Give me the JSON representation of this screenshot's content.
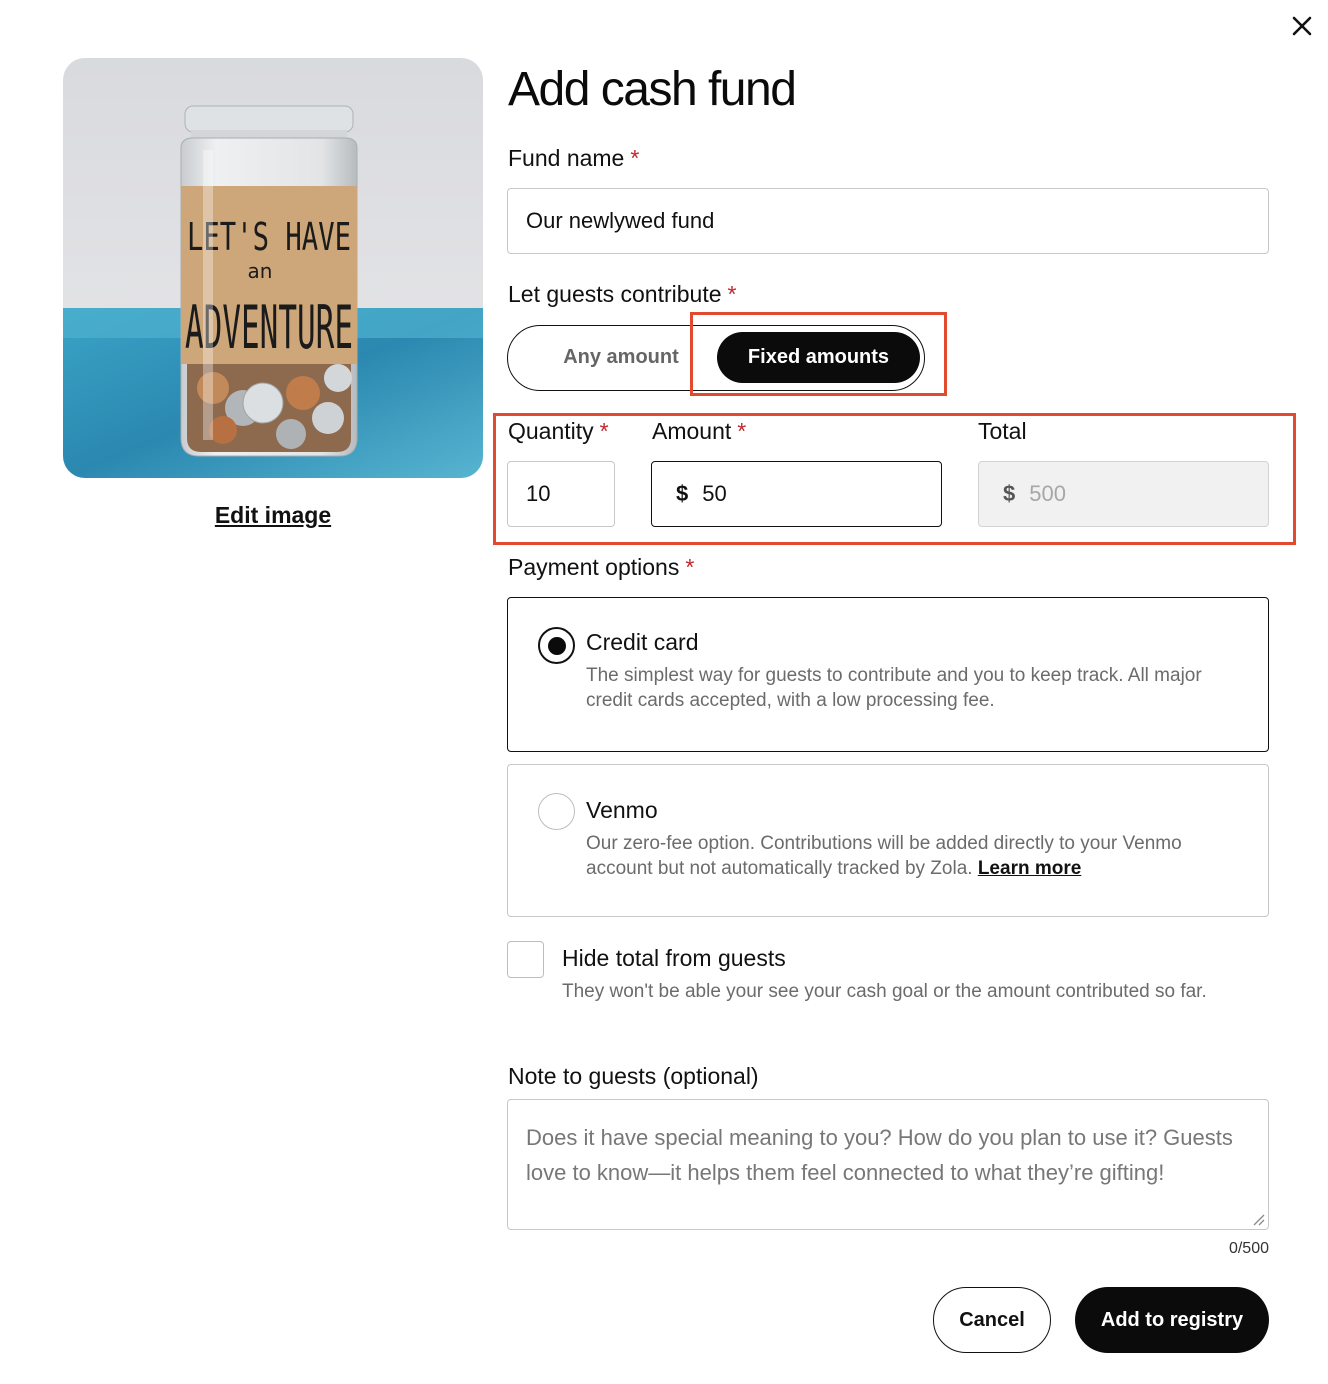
{
  "dialog": {
    "title": "Add cash fund",
    "close_icon": "close-icon"
  },
  "image_panel": {
    "jar_label_line1": "LET'S HAVE",
    "jar_label_line2": "an",
    "jar_label_line3": "ADVENTURE",
    "edit_label": "Edit image"
  },
  "fund_name": {
    "label": "Fund name",
    "required_mark": "*",
    "value": "Our newlywed fund"
  },
  "contribute": {
    "label": "Let guests contribute",
    "required_mark": "*",
    "options": [
      "Any amount",
      "Fixed amounts"
    ],
    "selected": "Fixed amounts"
  },
  "amounts": {
    "quantity_label": "Quantity",
    "quantity_value": "10",
    "amount_label": "Amount",
    "amount_currency": "$",
    "amount_value": "50",
    "total_label": "Total",
    "total_currency": "$",
    "total_value": "500",
    "required_mark": "*"
  },
  "payment": {
    "label": "Payment options",
    "required_mark": "*",
    "options": [
      {
        "title": "Credit card",
        "description": "The simplest way for guests to contribute and you to keep track. All major credit cards accepted, with a low processing fee.",
        "selected": true
      },
      {
        "title": "Venmo",
        "description": "Our zero-fee option. Contributions will be added directly to your Venmo account but not automatically tracked by Zola.",
        "link": "Learn more",
        "selected": false
      }
    ]
  },
  "hide_total": {
    "title": "Hide total from guests",
    "description": "They won't be able your see your cash goal or the amount contributed so far.",
    "checked": false
  },
  "note": {
    "label": "Note to guests (optional)",
    "placeholder": "Does it have special meaning to you? How do you plan to use it? Guests love to know—it helps them feel connected to what they’re gifting!",
    "counter": "0/500"
  },
  "actions": {
    "cancel": "Cancel",
    "submit": "Add to registry"
  },
  "colors": {
    "accent": "#0b0b0b",
    "required": "#c0282e",
    "highlight": "#e04a2f"
  }
}
